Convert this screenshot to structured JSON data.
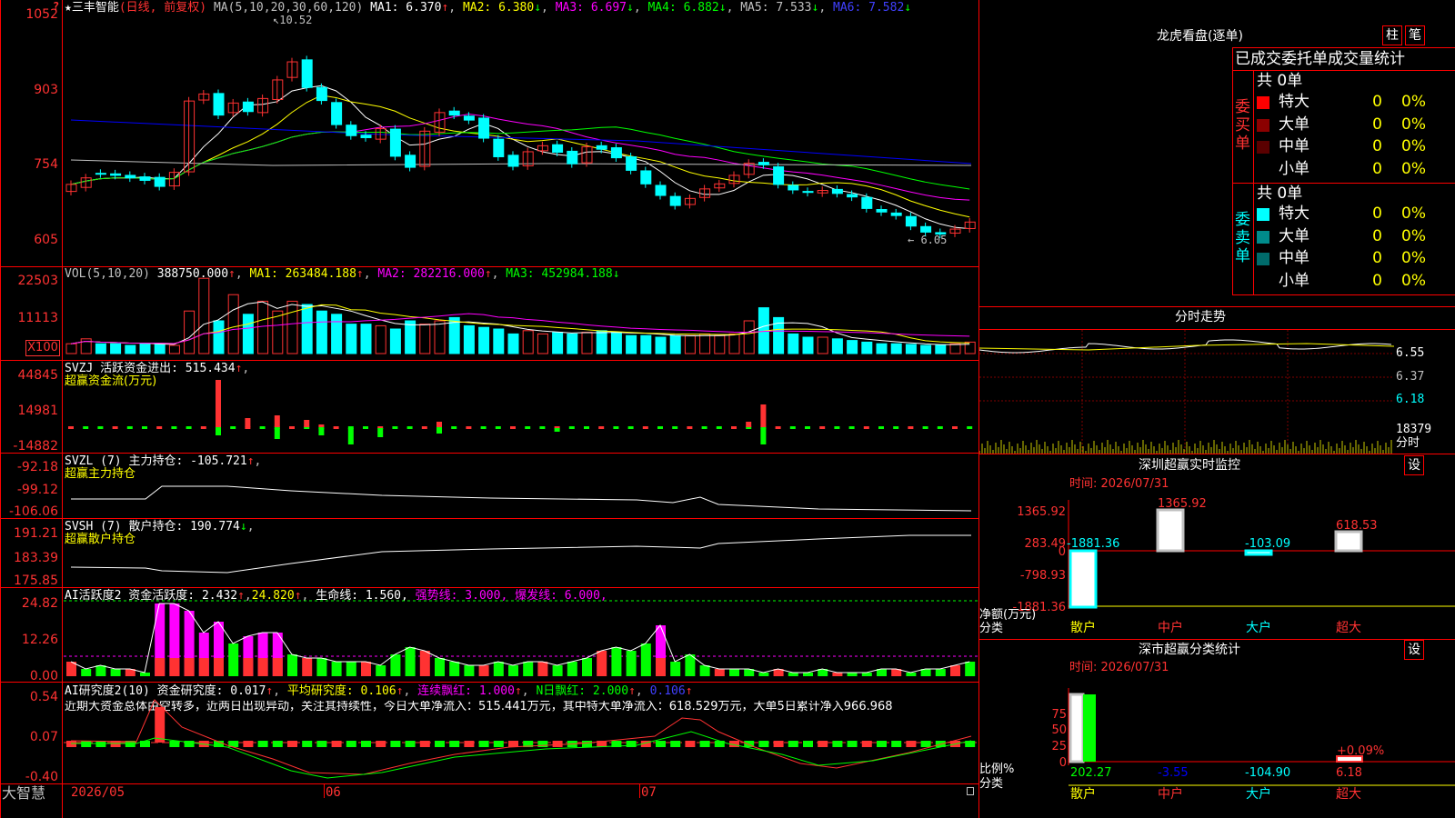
{
  "colors": {
    "up": "#ff3232",
    "down": "#00ffff",
    "ma1": "#ffffff",
    "ma2": "#ffff00",
    "ma3": "#ff00ff",
    "ma4": "#00ff00",
    "ma5": "#c0c0c0",
    "ma6": "#0000ff",
    "frame": "#ff0000"
  },
  "left_panel": {
    "bottom_label": "大智慧"
  },
  "price_panel": {
    "stock_name": "★三丰智能",
    "period_label": "(日线, 前复权)",
    "ma_params": "MA(5,10,20,30,60,120)",
    "ma1": "MA1: 6.370",
    "ma2": "MA2: 6.380",
    "ma3": "MA3: 6.697",
    "ma4": "MA4: 6.882",
    "ma5": "MA5: 7.533",
    "ma6": "MA6: 7.582",
    "high_marker": "10.52",
    "low_marker": "6.05",
    "axis": [
      "1052",
      "903",
      "754",
      "605"
    ]
  },
  "vol_panel": {
    "label": "VOL(5,10,20)",
    "value": "388750.000",
    "ma1": "MA1: 263484.188",
    "ma2": "MA2: 282216.000",
    "ma3": "MA3: 452984.188",
    "axis": [
      "22503",
      "11113"
    ],
    "unit": "X100"
  },
  "svzj_panel": {
    "label": "SVZJ 活跃资金进出: 515.434",
    "sub": "超赢资金流(万元)",
    "axis": [
      "44845",
      "14981",
      "-14882"
    ]
  },
  "svzl_panel": {
    "label": "SVZL (7) 主力持仓: -105.721",
    "sub": "超赢主力持仓",
    "axis": [
      "-92.18",
      "-99.12",
      "-106.06"
    ]
  },
  "svsh_panel": {
    "label": "SVSH (7) 散户持仓: 190.774",
    "sub": "超赢散户持仓",
    "axis": [
      "191.21",
      "183.39",
      "175.85"
    ]
  },
  "ai_panel": {
    "label": "AI活跃度2 资金活跃度: 2.432",
    "v1": "24.820",
    "life": "生命线: 1.560,",
    "strong": "强势线: 3.000,",
    "burst": "爆发线: 6.000,",
    "axis": [
      "24.82",
      "12.26",
      "0.00"
    ]
  },
  "ai2_panel": {
    "label": "AI研究度2(10) 资金研究度: 0.017",
    "avg": "平均研究度: 0.106",
    "cont": "连续飘红: 1.000",
    "nred": "N日飘红: 2.000",
    "last": "0.106",
    "comment": "近期大资金总体由空转多，近两日出现异动，关注其持续性，今日大单净流入：515.441万元，其中特大单净流入：618.529万元，大单5日累计净入966.968",
    "axis": [
      "0.54",
      "0.07",
      "-0.40"
    ]
  },
  "date_axis": [
    "2026/05",
    "06",
    "07"
  ],
  "right": {
    "title": "龙虎看盘(逐单)",
    "btn1": "柱",
    "btn2": "笔",
    "stats_header": "已成交委托单成交量统计",
    "buy": {
      "side_label": "委买单",
      "total": "共 0单",
      "rows": [
        {
          "label": "特大",
          "count": "0",
          "pct": "0%",
          "color": "#ff0000"
        },
        {
          "label": "大单",
          "count": "0",
          "pct": "0%",
          "color": "#8b0000"
        },
        {
          "label": "中单",
          "count": "0",
          "pct": "0%",
          "color": "#5a0000"
        },
        {
          "label": "小单",
          "count": "0",
          "pct": "0%",
          "color": ""
        }
      ]
    },
    "sell": {
      "side_label": "委卖单",
      "total": "共 0单",
      "rows": [
        {
          "label": "特大",
          "count": "0",
          "pct": "0%",
          "color": "#00ffff"
        },
        {
          "label": "大单",
          "count": "0",
          "pct": "0%",
          "color": "#008b8b"
        },
        {
          "label": "中单",
          "count": "0",
          "pct": "0%",
          "color": "#006b6b"
        },
        {
          "label": "小单",
          "count": "0",
          "pct": "0%",
          "color": ""
        }
      ]
    },
    "intraday": {
      "title": "分时走势",
      "axis": [
        "6.55",
        "6.37",
        "6.18"
      ],
      "vol_label": "18379",
      "vol_unit": "分时"
    },
    "monitor": {
      "title": "深圳超赢实时监控",
      "set": "设",
      "time": "时间: 2026/07/31",
      "axis": [
        "1365.92",
        "283.49",
        "0",
        "-798.93",
        "-1881.36"
      ],
      "net_label": "净额(万元)",
      "cat_label": "分类",
      "values": [
        "-1881.36",
        "1365.92",
        "-103.09",
        "618.53"
      ],
      "cats": [
        "散户",
        "中户",
        "大户",
        "超大"
      ]
    },
    "classify": {
      "title": "深市超赢分类统计",
      "set": "设",
      "time": "时间: 2026/07/31",
      "axis": [
        "75",
        "50",
        "25",
        "0"
      ],
      "ratio_label": "比例%",
      "cat_label": "分类",
      "values": [
        "202.27",
        "-3.55",
        "-104.90",
        "6.18"
      ],
      "top_label": "+0.09%",
      "cats": [
        "散户",
        "中户",
        "大户",
        "超大"
      ]
    }
  }
}
